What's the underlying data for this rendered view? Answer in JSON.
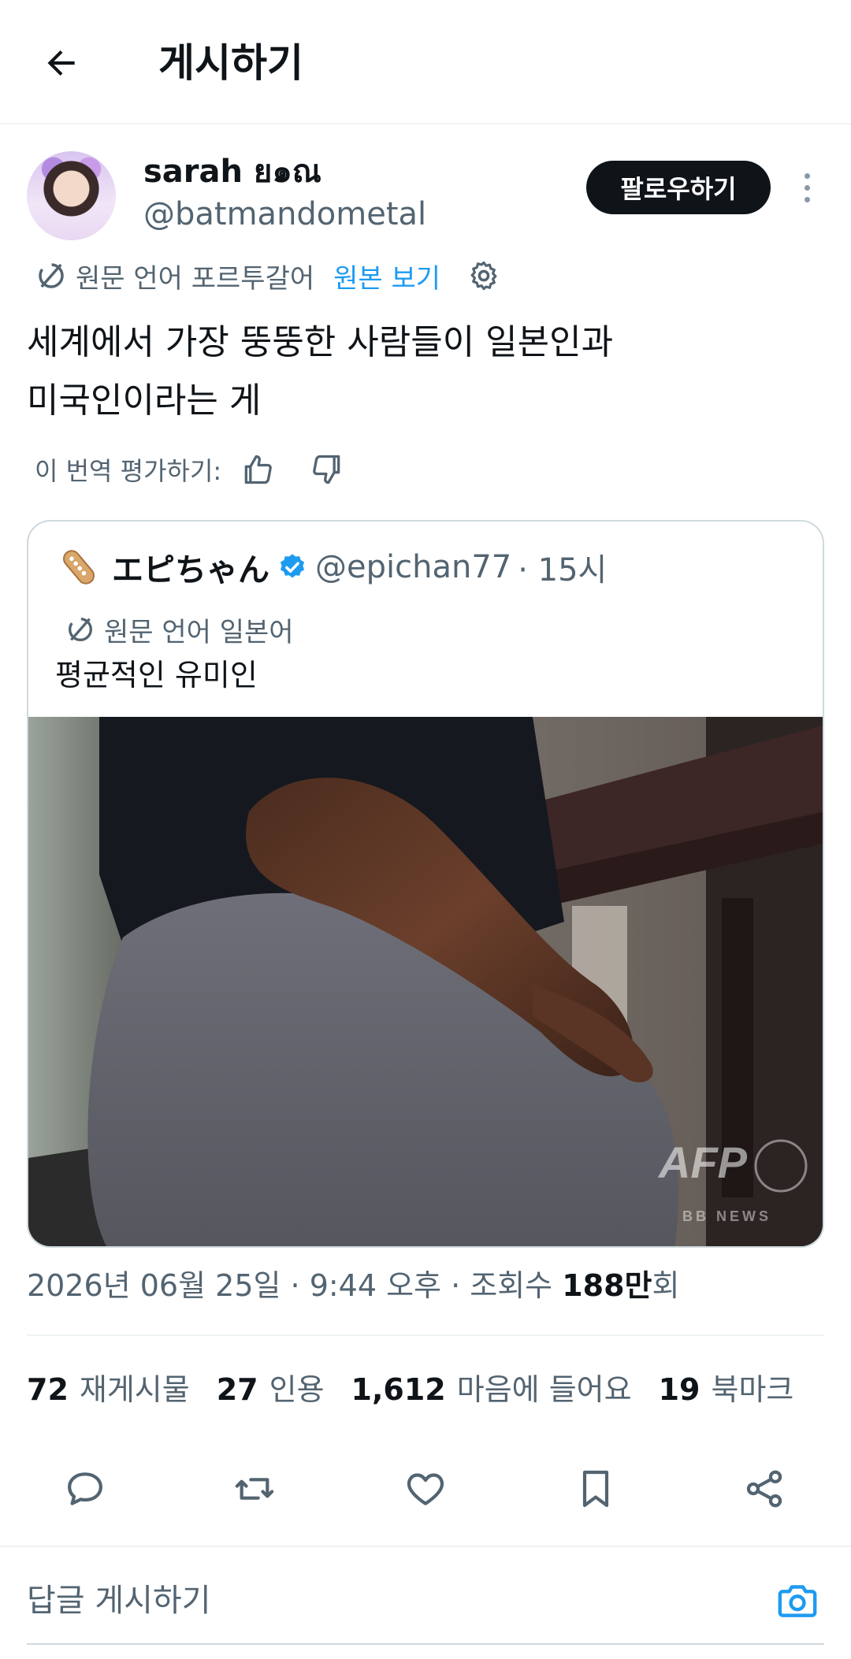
{
  "header": {
    "title": "게시하기",
    "back_icon": "arrow-left-icon"
  },
  "author": {
    "display_name": "sarah ย๑ณ",
    "handle": "@batmandometal",
    "follow_label": "팔로우하기"
  },
  "translation": {
    "source_label": "원문 언어 포르투갈어",
    "show_original": "원본 보기"
  },
  "tweet": {
    "lines": [
      "세계에서 가장 뚱뚱한 사람들이 일본인과",
      "미국인이라는 게"
    ]
  },
  "rating": {
    "label": "이 번역 평가하기:"
  },
  "quote": {
    "name": "エピちゃん",
    "handle": "@epichan77",
    "time": "· 15시",
    "source_label": "원문 언어 일본어",
    "text": "평균적인 유미인",
    "image_watermark": "AFP",
    "image_watermark_sub": "BB NEWS"
  },
  "timestamp": {
    "date_time": "2026년 06월 25일 · 9:44 오후 · 조회수 ",
    "views": "188만",
    "views_suffix": "회"
  },
  "stats": [
    {
      "count": "72",
      "label": "재게시물"
    },
    {
      "count": "27",
      "label": "인용"
    },
    {
      "count": "1,612",
      "label": "마음에 들어요"
    },
    {
      "count": "19",
      "label": "북마크"
    }
  ],
  "reply": {
    "placeholder": "답글 게시하기"
  },
  "colors": {
    "accent": "#1d9bf0",
    "text": "#0f1419",
    "muted": "#536471",
    "border": "#cfd9de"
  }
}
